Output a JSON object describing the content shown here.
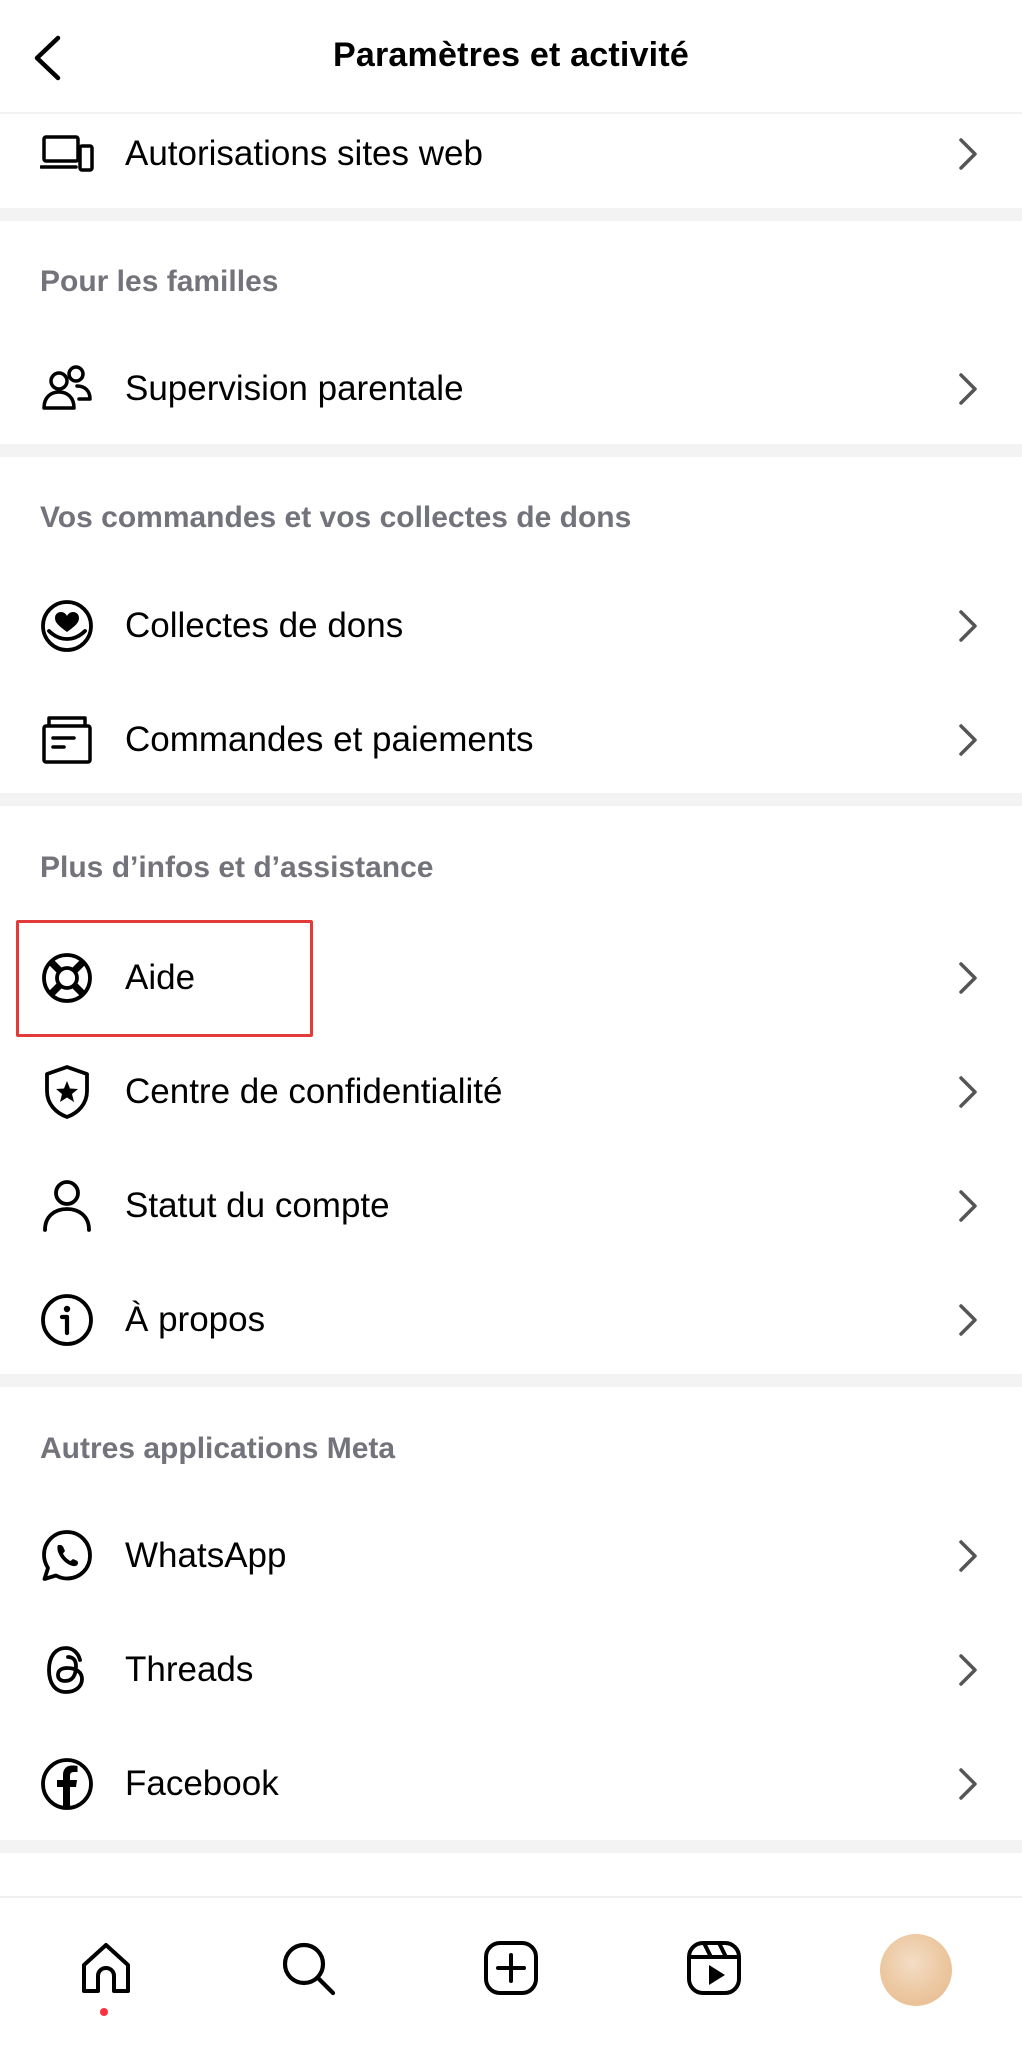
{
  "header": {
    "title": "Paramètres et activité"
  },
  "sections": {
    "top": {
      "items": [
        {
          "label": "Autorisations sites web",
          "icon": "devices-icon"
        }
      ]
    },
    "families": {
      "title": "Pour les familles",
      "items": [
        {
          "label": "Supervision parentale",
          "icon": "people-icon"
        }
      ]
    },
    "orders": {
      "title": "Vos commandes et vos collectes de dons",
      "items": [
        {
          "label": "Collectes de dons",
          "icon": "heart-coin-icon"
        },
        {
          "label": "Commandes et paiements",
          "icon": "box-icon"
        }
      ]
    },
    "support": {
      "title": "Plus d’infos et d’assistance",
      "items": [
        {
          "label": "Aide",
          "icon": "lifebuoy-icon"
        },
        {
          "label": "Centre de confidentialité",
          "icon": "shield-star-icon"
        },
        {
          "label": "Statut du compte",
          "icon": "person-icon"
        },
        {
          "label": "À propos",
          "icon": "info-icon"
        }
      ]
    },
    "meta": {
      "title": "Autres applications Meta",
      "items": [
        {
          "label": "WhatsApp",
          "icon": "whatsapp-icon"
        },
        {
          "label": "Threads",
          "icon": "threads-icon"
        },
        {
          "label": "Facebook",
          "icon": "facebook-icon"
        }
      ]
    }
  },
  "bottom_nav": {
    "items": [
      "home-icon",
      "search-icon",
      "create-icon",
      "reels-icon",
      "profile-avatar"
    ],
    "active": "home-icon"
  },
  "colors": {
    "highlight": "#e33a3a",
    "section_title": "#73737c",
    "separator": "#f3f3f3",
    "notification_dot": "#ff3040"
  }
}
